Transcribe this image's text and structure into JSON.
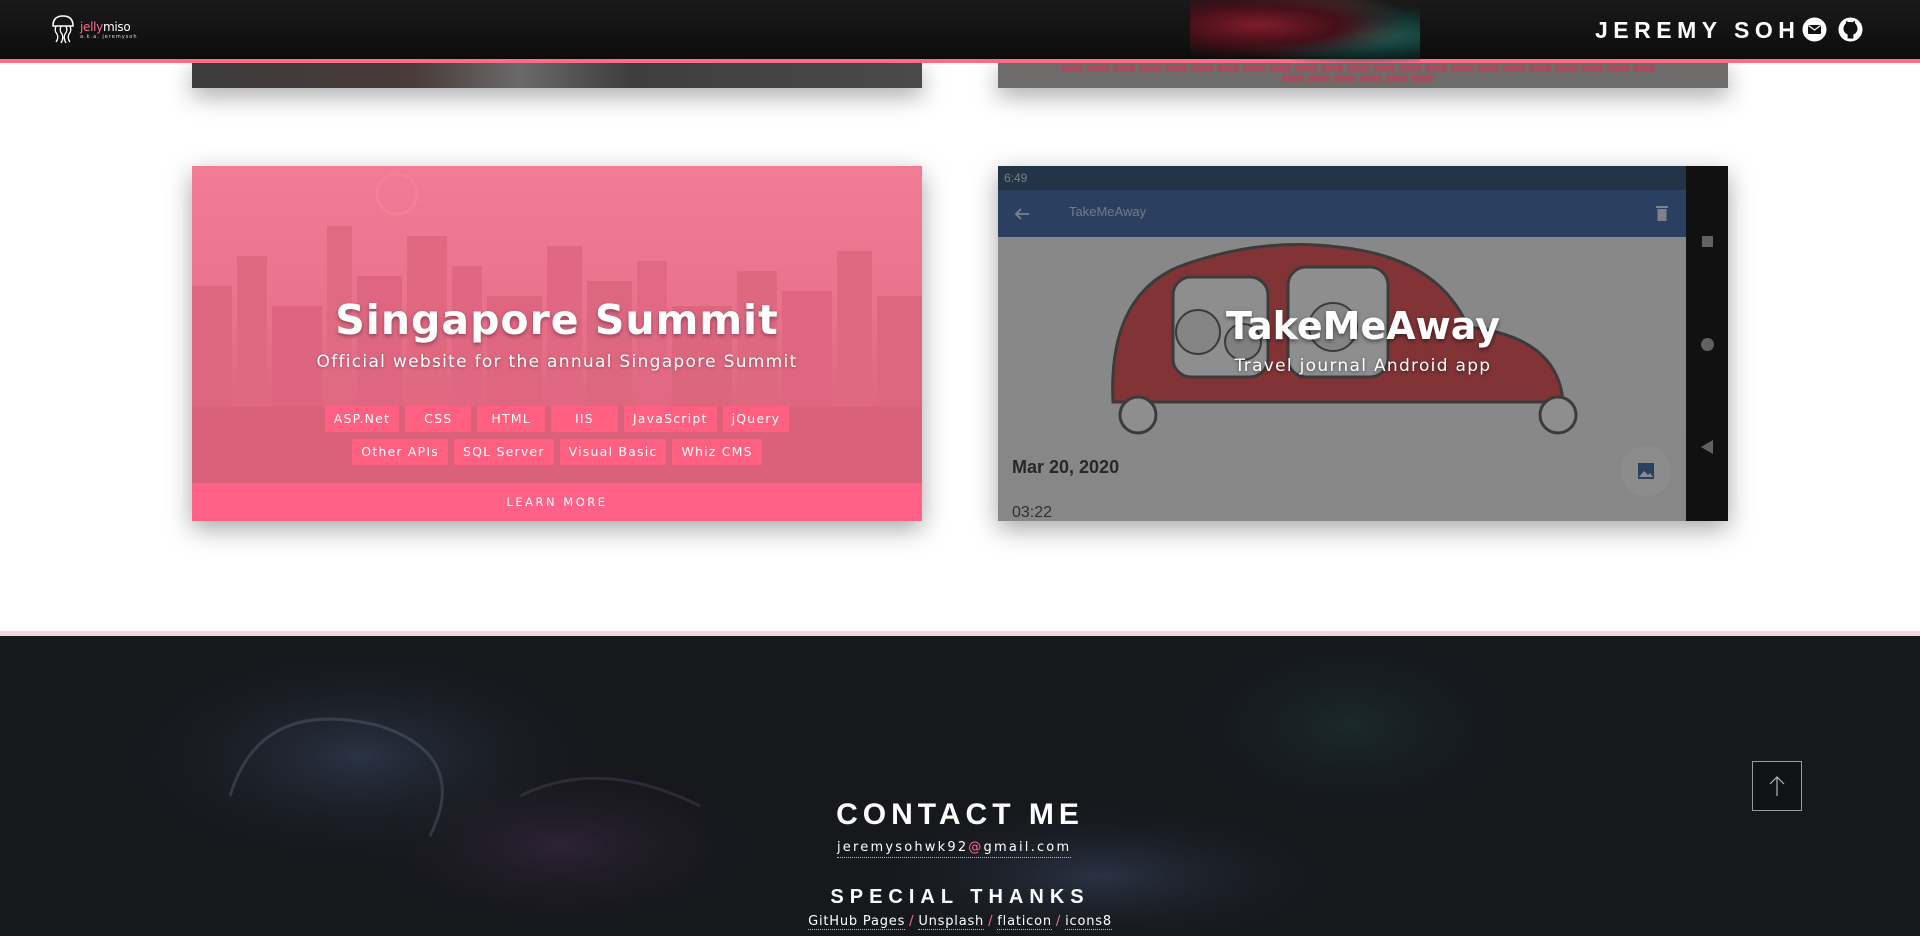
{
  "header": {
    "logo": {
      "name_part1": "jelly",
      "name_part2": "miso",
      "tagline": "a.k.a. jeremysoh"
    },
    "site_name": "JEREMY SOH",
    "icons": [
      "mail-icon",
      "github-icon"
    ]
  },
  "projects": [
    {
      "title": "Singapore Summit",
      "description": "Official website for the annual Singapore Summit",
      "tags": [
        "ASP.Net",
        "CSS",
        "HTML",
        "IIS",
        "JavaScript",
        "jQuery",
        "Other APIs",
        "SQL Server",
        "Visual Basic",
        "Whiz CMS"
      ],
      "button": "LEARN MORE"
    },
    {
      "title": "TakeMeAway",
      "description": "Travel journal Android app",
      "screenshot": {
        "status_time": "6:49",
        "app_title": "TakeMeAway",
        "date": "Mar 20, 2020",
        "time": "03:22"
      }
    }
  ],
  "footer": {
    "contact_title": "CONTACT ME",
    "email_user": "jeremysohwk92",
    "email_at": "@",
    "email_domain": "gmail.com",
    "thanks_title": "SPECIAL THANKS",
    "thanks": [
      "GitHub Pages",
      "Unsplash",
      "flaticon",
      "icons8"
    ],
    "separator": "/"
  },
  "colors": {
    "accent": "#ff6b89",
    "header_bg": "#111111",
    "footer_bg": "#16181c"
  }
}
